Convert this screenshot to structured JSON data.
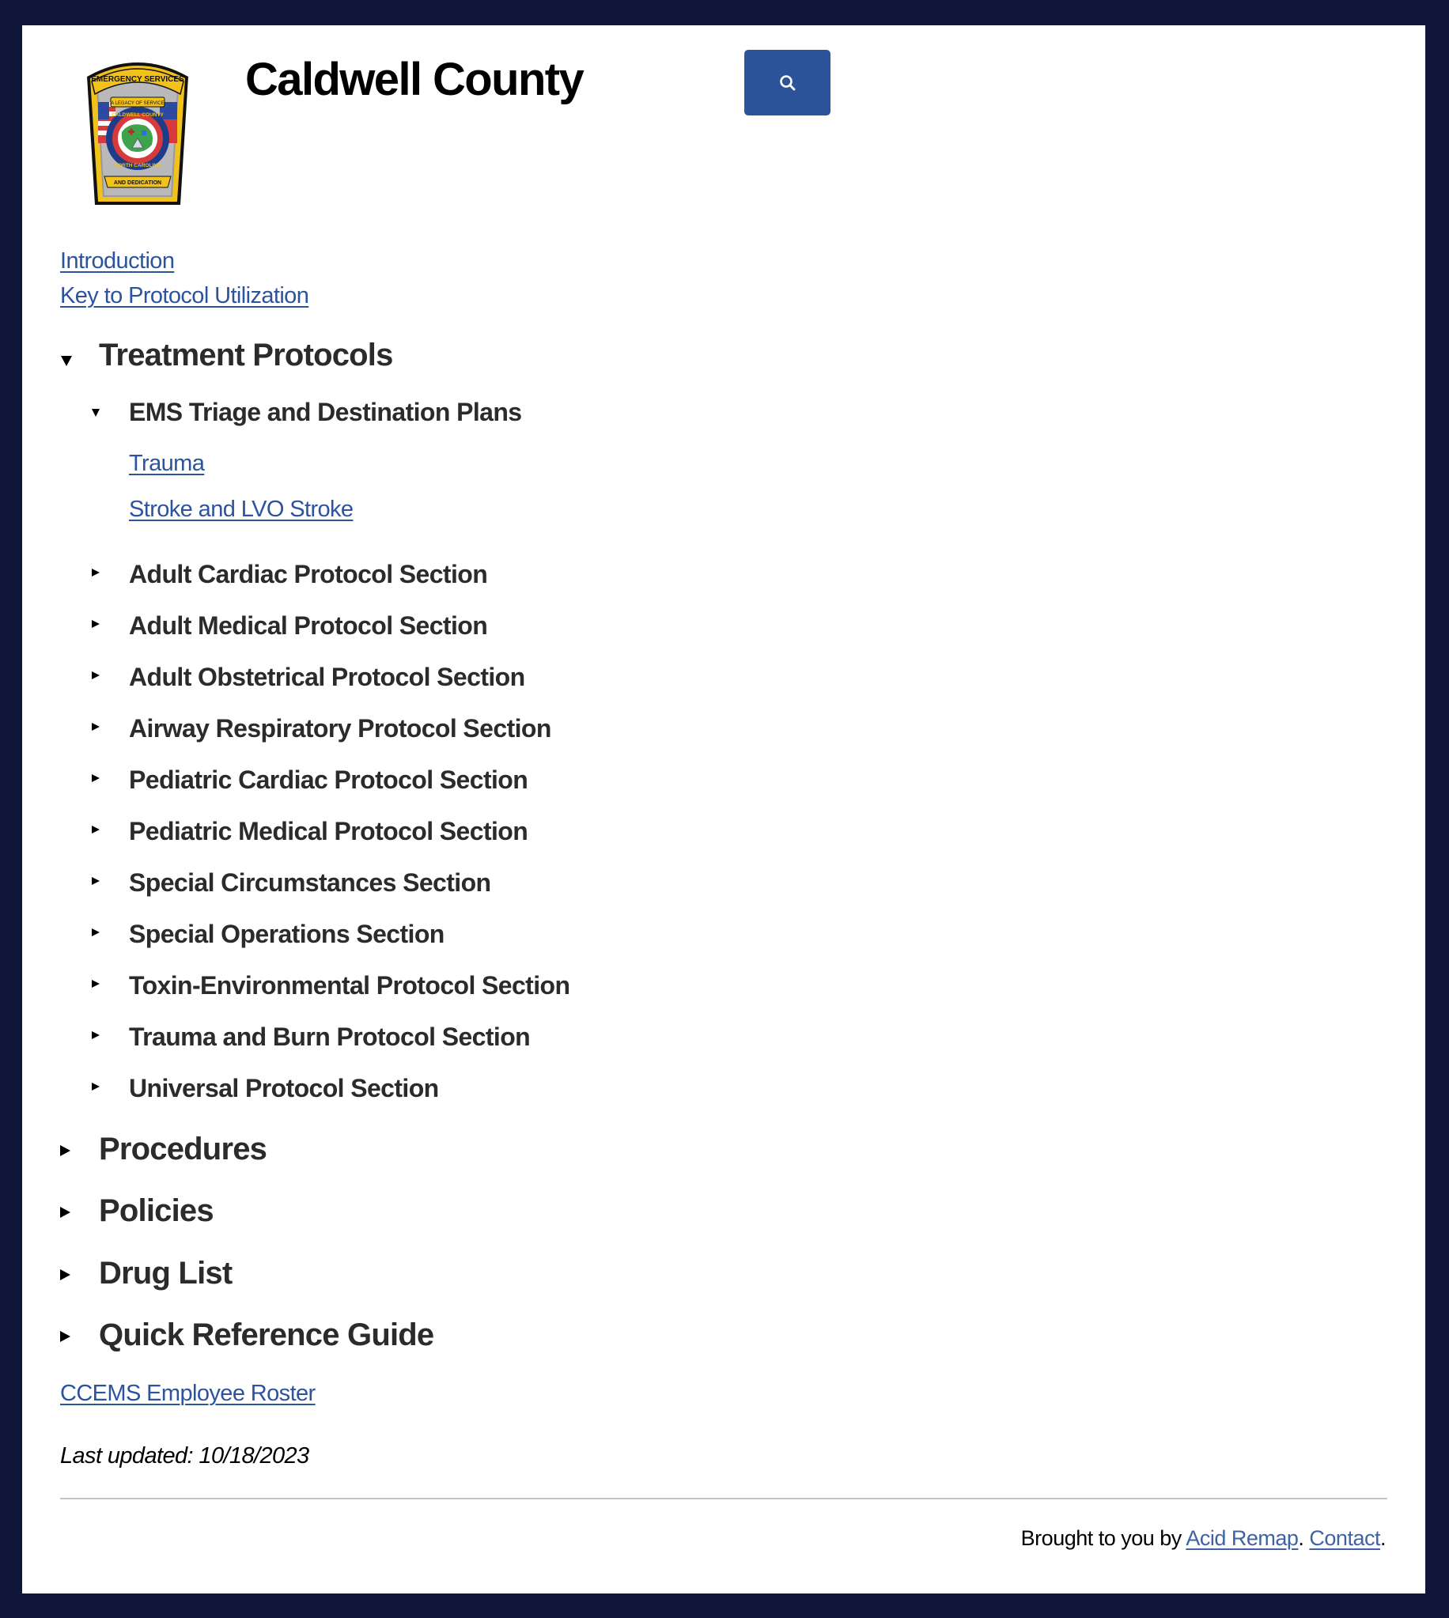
{
  "header": {
    "title": "Caldwell County",
    "logo_alt": "Caldwell County Emergency Services badge",
    "logo_text": {
      "top_arc": "EMERGENCY SERVICES",
      "ribbon_top": "A LEGACY OF SERVICE",
      "ring_top": "CALDWELL COUNTY",
      "ring_bottom": "NORTH CAROLINA",
      "ribbon_bottom": "AND DEDICATION"
    },
    "search_button": {
      "icon": "search-icon",
      "color": "#2b549a"
    }
  },
  "top_links": [
    {
      "label": "Introduction"
    },
    {
      "label": "Key to Protocol Utilization"
    }
  ],
  "tree": {
    "treatment_protocols": {
      "label": "Treatment Protocols",
      "expanded": true,
      "ems_triage": {
        "label": "EMS Triage and Destination Plans",
        "expanded": true,
        "links": [
          {
            "label": "Trauma"
          },
          {
            "label": "Stroke and LVO Stroke"
          }
        ]
      },
      "sections": [
        {
          "label": "Adult Cardiac Protocol Section",
          "expanded": false
        },
        {
          "label": "Adult Medical Protocol Section",
          "expanded": false
        },
        {
          "label": "Adult Obstetrical Protocol Section",
          "expanded": false
        },
        {
          "label": "Airway Respiratory Protocol Section",
          "expanded": false
        },
        {
          "label": "Pediatric Cardiac Protocol Section",
          "expanded": false
        },
        {
          "label": "Pediatric Medical Protocol Section",
          "expanded": false
        },
        {
          "label": "Special Circumstances Section",
          "expanded": false
        },
        {
          "label": "Special Operations Section",
          "expanded": false
        },
        {
          "label": "Toxin-Environmental Protocol Section",
          "expanded": false
        },
        {
          "label": "Trauma and Burn Protocol Section",
          "expanded": false
        },
        {
          "label": "Universal Protocol Section",
          "expanded": false
        }
      ]
    },
    "top_sections": [
      {
        "label": "Procedures",
        "expanded": false
      },
      {
        "label": "Policies",
        "expanded": false
      },
      {
        "label": "Drug List",
        "expanded": false
      },
      {
        "label": "Quick Reference Guide",
        "expanded": false
      }
    ]
  },
  "roster_link": {
    "label": "CCEMS Employee Roster"
  },
  "last_updated": "Last updated: 10/18/2023",
  "footer": {
    "prefix": "Brought to you by ",
    "acid_remap_label": "Acid Remap",
    "sep": ". ",
    "contact_label": "Contact",
    "suffix": "."
  },
  "colors": {
    "background": "#10163a",
    "panel": "#ffffff",
    "link": "#2c539e",
    "heading": "#2b2b2b",
    "accent_button": "#2b549a"
  }
}
